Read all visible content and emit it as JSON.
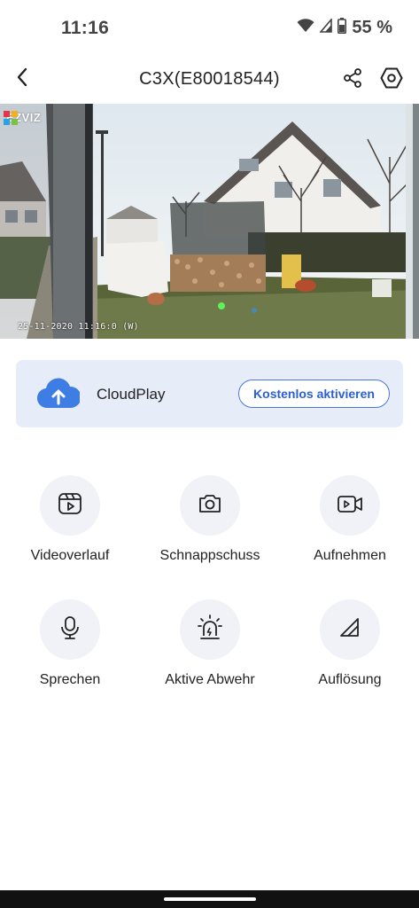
{
  "status_bar": {
    "time": "11:16",
    "battery_percent": "55 %",
    "icons": [
      "wifi-icon",
      "signal-icon",
      "battery-icon"
    ]
  },
  "header": {
    "title": "C3X(E80018544)",
    "back_icon": "chevron-left-icon",
    "share_icon": "share-icon",
    "settings_icon": "settings-hexagon-icon"
  },
  "video": {
    "brand": "EZVIZ",
    "timestamp": "25-11-2020 11:16:0  (W)"
  },
  "cloud_banner": {
    "icon": "cloud-upload-icon",
    "label": "CloudPlay",
    "button_label": "Kostenlos aktivieren",
    "accent_color": "#2c5fd6"
  },
  "actions": [
    {
      "label": "Videoverlauf",
      "icon": "video-history-icon"
    },
    {
      "label": "Schnappschuss",
      "icon": "camera-icon"
    },
    {
      "label": "Aufnehmen",
      "icon": "video-record-icon"
    },
    {
      "label": "Sprechen",
      "icon": "microphone-icon"
    },
    {
      "label": "Aktive Abwehr",
      "icon": "alarm-siren-icon"
    },
    {
      "label": "Auflösung",
      "icon": "resolution-icon"
    }
  ]
}
